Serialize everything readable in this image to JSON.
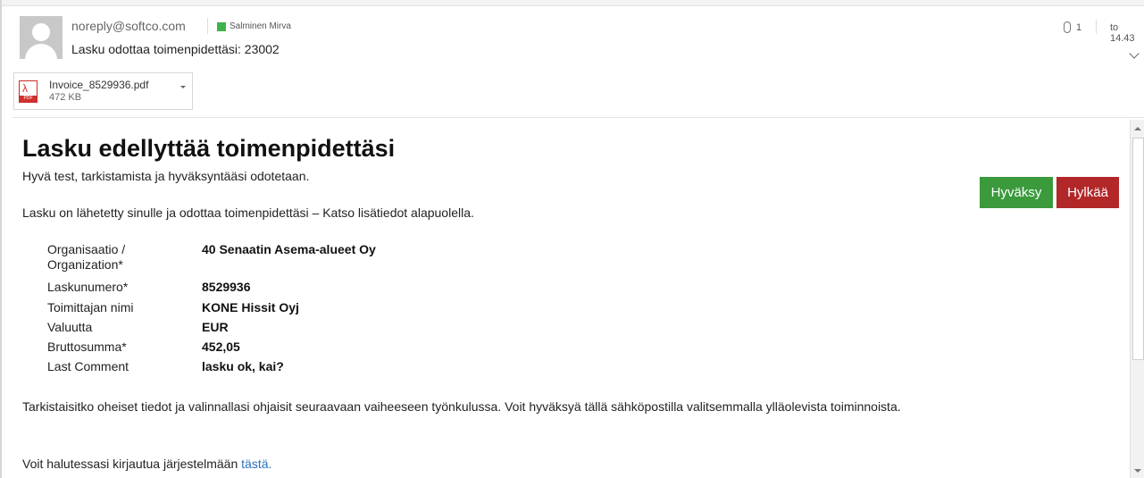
{
  "header": {
    "sender": "noreply@softco.com",
    "recipient": "Salminen Mirva",
    "subject": "Lasku odottaa toimenpidettäsi: 23002",
    "attachment_count": "1",
    "time": "to 14.43"
  },
  "attachment": {
    "filename": "Invoice_8529936.pdf",
    "size": "472 KB",
    "type_label": "PDF"
  },
  "body": {
    "title": "Lasku edellyttää toimenpidettäsi",
    "greeting": "Hyvä test, tarkistamista ja hyväksyntääsi odotetaan.",
    "intro": "Lasku on lähetetty sinulle ja odottaa toimenpidettäsi – Katso lisätiedot alapuolella.",
    "details": [
      {
        "label": "Organisaatio / Organization*",
        "value": "40 Senaatin Asema-alueet Oy"
      },
      {
        "label": "Laskunumero*",
        "value": "8529936"
      },
      {
        "label": "Toimittajan nimi",
        "value": "KONE Hissit Oyj"
      },
      {
        "label": "Valuutta",
        "value": "EUR"
      },
      {
        "label": "Bruttosumma*",
        "value": "452,05"
      },
      {
        "label": "Last Comment",
        "value": "lasku ok, kai?"
      }
    ],
    "instructions": "Tarkistaisitko oheiset tiedot ja valinnallasi ohjaisit seuraavaan vaiheeseen työnkulussa. Voit hyväksyä tällä sähköpostilla valitsemmalla ylläolevista toiminnoista.",
    "login_prefix": "Voit halutessasi kirjautua järjestelmään ",
    "login_link": "tästä."
  },
  "actions": {
    "approve": "Hyväksy",
    "reject": "Hylkää"
  },
  "colors": {
    "approve": "#3a9a3c",
    "reject": "#b22728",
    "link": "#2a72c0",
    "status": "#3cb44b"
  }
}
